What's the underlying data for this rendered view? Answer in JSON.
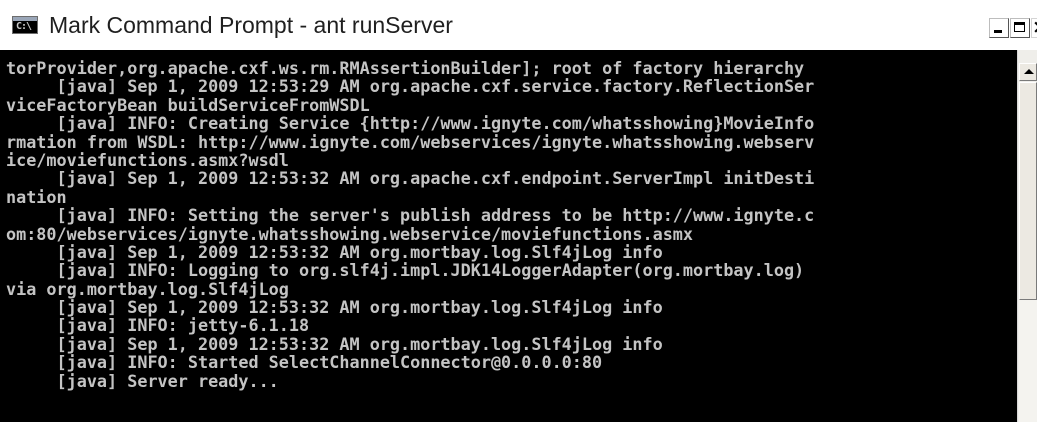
{
  "window": {
    "title": "Mark Command Prompt - ant runServer",
    "icon": "command-prompt-icon",
    "icon_glyph": "C:\\",
    "controls": {
      "minimize": "minimize-icon",
      "maximize": "maximize-icon",
      "close": "close-icon",
      "close_glyph": "×"
    }
  },
  "console": {
    "background": "#000000",
    "text_color": "#c0c0c0",
    "lines": [
      "torProvider,org.apache.cxf.ws.rm.RMAssertionBuilder]; root of factory hierarchy",
      "     [java] Sep 1, 2009 12:53:29 AM org.apache.cxf.service.factory.ReflectionSer",
      "viceFactoryBean buildServiceFromWSDL",
      "     [java] INFO: Creating Service {http://www.ignyte.com/whatsshowing}MovieInfo",
      "rmation from WSDL: http://www.ignyte.com/webservices/ignyte.whatsshowing.webserv",
      "ice/moviefunctions.asmx?wsdl",
      "     [java] Sep 1, 2009 12:53:32 AM org.apache.cxf.endpoint.ServerImpl initDesti",
      "nation",
      "     [java] INFO: Setting the server's publish address to be http://www.ignyte.c",
      "om:80/webservices/ignyte.whatsshowing.webservice/moviefunctions.asmx",
      "     [java] Sep 1, 2009 12:53:32 AM org.mortbay.log.Slf4jLog info",
      "     [java] INFO: Logging to org.slf4j.impl.JDK14LoggerAdapter(org.mortbay.log)",
      "via org.mortbay.log.Slf4jLog",
      "     [java] Sep 1, 2009 12:53:32 AM org.mortbay.log.Slf4jLog info",
      "     [java] INFO: jetty-6.1.18",
      "     [java] Sep 1, 2009 12:53:32 AM org.mortbay.log.Slf4jLog info",
      "     [java] INFO: Started SelectChannelConnector@0.0.0.0:80",
      "     [java] Server ready..."
    ]
  },
  "scrollbar": {
    "up_arrow": "scroll-up-arrow-icon"
  }
}
